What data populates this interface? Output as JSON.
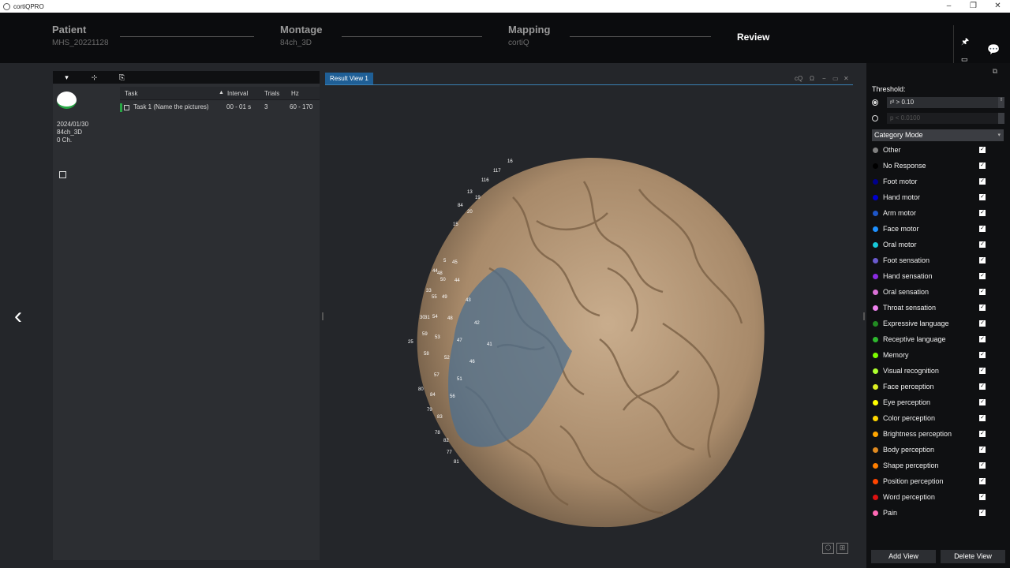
{
  "app": {
    "title": "cortiQPRO"
  },
  "steps": [
    {
      "name": "Patient",
      "sub": "MHS_20221128"
    },
    {
      "name": "Montage",
      "sub": "84ch_3D"
    },
    {
      "name": "Mapping",
      "sub": "cortiQ"
    },
    {
      "name": "Review",
      "sub": ""
    }
  ],
  "patient": {
    "date": "2024/01/30",
    "montage": "84ch_3D",
    "channels": "0 Ch."
  },
  "task_table": {
    "headers": [
      "Task",
      "Interval",
      "Trials",
      "Hz"
    ],
    "rows": [
      {
        "task": "Task 1  (Name the pictures)",
        "interval": "00 - 01 s",
        "trials": "3",
        "hz": "60 - 170"
      }
    ]
  },
  "view": {
    "tab": "Result View 1",
    "controls": [
      "cQ",
      "Ω",
      "−",
      "▭",
      "✕"
    ]
  },
  "electrodes": [
    "16",
    "117",
    "116",
    "13",
    "19",
    "84",
    "20",
    "15",
    "5",
    "45",
    "44",
    "48",
    "50",
    "44",
    "33",
    "55",
    "49",
    "43",
    "31",
    "30",
    "54",
    "48",
    "42",
    "25",
    "59",
    "53",
    "47",
    "41",
    "58",
    "52",
    "46",
    "57",
    "51",
    "80",
    "84",
    "56",
    "79",
    "83",
    "78",
    "82",
    "77",
    "81"
  ],
  "threshold": {
    "label": "Threshold:",
    "r2": "r² > 0.10",
    "p": "p < 0.0100"
  },
  "category_mode": {
    "label": "Category Mode"
  },
  "categories": [
    {
      "label": "Other",
      "color": "#808080"
    },
    {
      "label": "No Response",
      "color": "#000000"
    },
    {
      "label": "Foot motor",
      "color": "#00008b"
    },
    {
      "label": "Hand motor",
      "color": "#0000cd"
    },
    {
      "label": "Arm motor",
      "color": "#1e56c8"
    },
    {
      "label": "Face motor",
      "color": "#1e90ff"
    },
    {
      "label": "Oral motor",
      "color": "#17c9d9"
    },
    {
      "label": "Foot sensation",
      "color": "#6a5acd"
    },
    {
      "label": "Hand sensation",
      "color": "#8a2be2"
    },
    {
      "label": "Oral sensation",
      "color": "#da70d6"
    },
    {
      "label": "Throat sensation",
      "color": "#ee82ee"
    },
    {
      "label": "Expressive language",
      "color": "#228b22"
    },
    {
      "label": "Receptive language",
      "color": "#2eb82e"
    },
    {
      "label": "Memory",
      "color": "#7cfc00"
    },
    {
      "label": "Visual recognition",
      "color": "#adff2f"
    },
    {
      "label": "Face perception",
      "color": "#ddee22"
    },
    {
      "label": "Eye perception",
      "color": "#ffff00"
    },
    {
      "label": "Color perception",
      "color": "#ffd700"
    },
    {
      "label": "Brightness perception",
      "color": "#ffa500"
    },
    {
      "label": "Body perception",
      "color": "#e08a20"
    },
    {
      "label": "Shape perception",
      "color": "#ff7f00"
    },
    {
      "label": "Position perception",
      "color": "#ff4500"
    },
    {
      "label": "Word perception",
      "color": "#dd1111"
    },
    {
      "label": "Pain",
      "color": "#ff69b4"
    }
  ],
  "buttons": {
    "add_view": "Add View",
    "delete_view": "Delete View"
  }
}
